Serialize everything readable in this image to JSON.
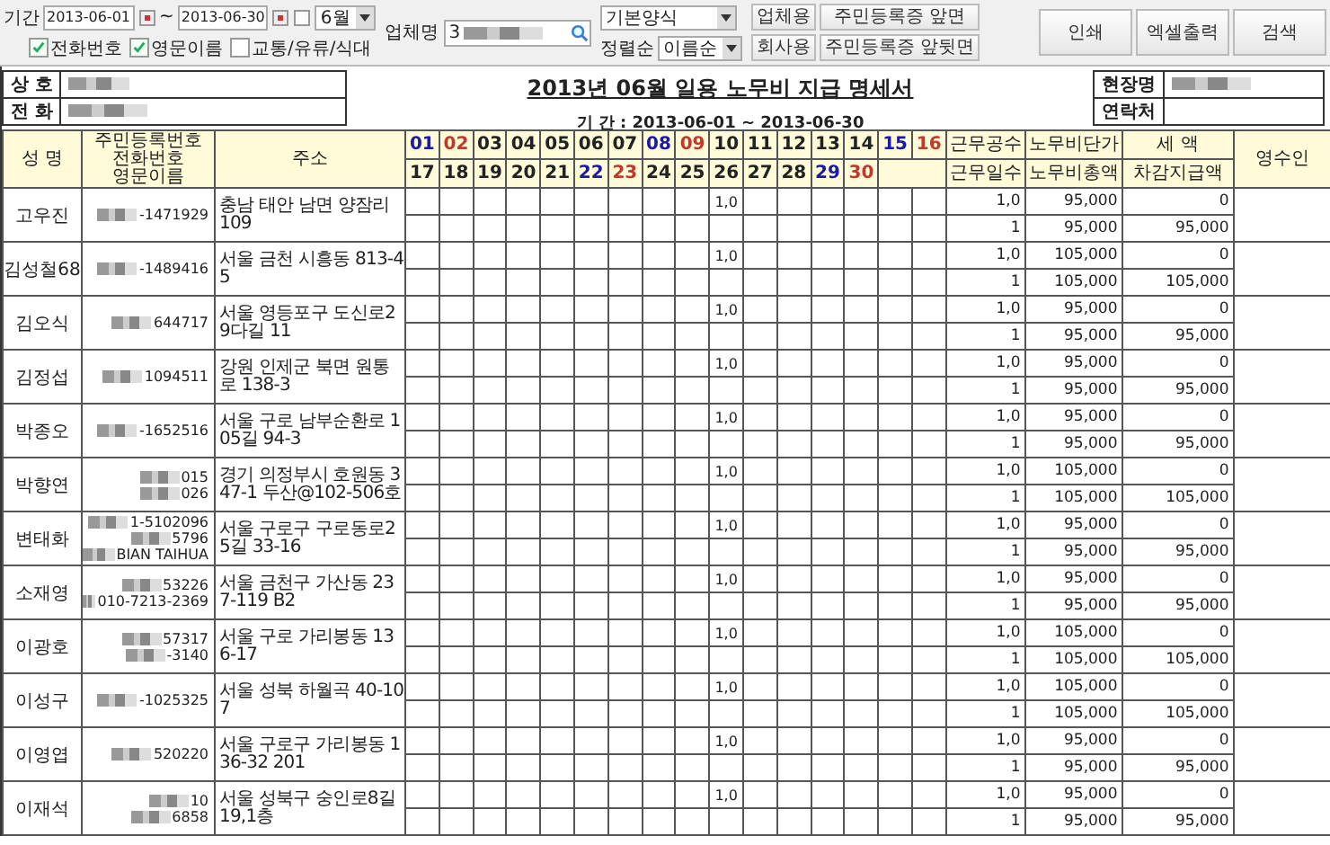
{
  "toolbar": {
    "period_label": "기간",
    "start_date": "2013-06-01",
    "separator": "~",
    "end_date": "2013-06-30",
    "month_select": "6월",
    "checkboxes": [
      {
        "label": "전화번호",
        "checked": true
      },
      {
        "label": "영문이름",
        "checked": true
      },
      {
        "label": "교통/유류/식대",
        "checked": false
      }
    ],
    "company_label": "업체명",
    "company_value": "3",
    "form_select": "기본양식",
    "sort_label": "정렬순",
    "sort_select": "이름순",
    "small_buttons": [
      "업체용",
      "주민등록증 앞면",
      "회사용",
      "주민등록증 앞뒷면"
    ],
    "big_buttons": [
      "인쇄",
      "엑셀출력",
      "검색"
    ]
  },
  "info": {
    "company_label": "상 호",
    "phone_label": "전 화",
    "title": "2013년 06월 일용 노무비 지급 명세서",
    "period": "기 간 : 2013-06-01 ~ 2013-06-30",
    "site_label": "현장명",
    "contact_label": "연락처"
  },
  "table": {
    "col_name": "성 명",
    "col_id": [
      "주민등록번호",
      "전화번호",
      "영문이름"
    ],
    "col_address": "주소",
    "days_top": [
      {
        "label": "01",
        "color": "#1a1aa6"
      },
      {
        "label": "02",
        "color": "#c0392b"
      },
      {
        "label": "03",
        "color": "#222222"
      },
      {
        "label": "04",
        "color": "#222222"
      },
      {
        "label": "05",
        "color": "#222222"
      },
      {
        "label": "06",
        "color": "#222222"
      },
      {
        "label": "07",
        "color": "#222222"
      },
      {
        "label": "08",
        "color": "#1a1aa6"
      },
      {
        "label": "09",
        "color": "#c0392b"
      },
      {
        "label": "10",
        "color": "#222222"
      },
      {
        "label": "11",
        "color": "#222222"
      },
      {
        "label": "12",
        "color": "#222222"
      },
      {
        "label": "13",
        "color": "#222222"
      },
      {
        "label": "14",
        "color": "#222222"
      },
      {
        "label": "15",
        "color": "#1a1aa6"
      },
      {
        "label": "16",
        "color": "#c0392b"
      }
    ],
    "days_bottom": [
      {
        "label": "17",
        "color": "#222222"
      },
      {
        "label": "18",
        "color": "#222222"
      },
      {
        "label": "19",
        "color": "#222222"
      },
      {
        "label": "20",
        "color": "#222222"
      },
      {
        "label": "21",
        "color": "#222222"
      },
      {
        "label": "22",
        "color": "#1a1aa6"
      },
      {
        "label": "23",
        "color": "#c0392b"
      },
      {
        "label": "24",
        "color": "#222222"
      },
      {
        "label": "25",
        "color": "#222222"
      },
      {
        "label": "26",
        "color": "#222222"
      },
      {
        "label": "27",
        "color": "#222222"
      },
      {
        "label": "28",
        "color": "#222222"
      },
      {
        "label": "29",
        "color": "#1a1aa6"
      },
      {
        "label": "30",
        "color": "#c0392b"
      }
    ],
    "col_work_units": "근무공수",
    "col_unit_price": "노무비단가",
    "col_tax": "세 액",
    "col_receipt": "영수인",
    "col_work_days": "근무일수",
    "col_total": "노무비총액",
    "col_net": "차감지급액",
    "rows": [
      {
        "name": "고우진",
        "id_lines": [
          "-1471929"
        ],
        "address": "충남 태안 남면 양잠리 109",
        "days_worked": [
          false,
          false,
          false,
          false,
          false,
          false,
          false,
          false,
          false,
          true,
          false,
          false,
          false,
          false,
          false,
          false
        ],
        "day_value": "1,0",
        "work_units": "1,0",
        "unit_price": "95,000",
        "tax": "0",
        "work_days": "1",
        "total": "95,000",
        "net": "95,000"
      },
      {
        "name": "김성철68",
        "id_lines": [
          "-1489416"
        ],
        "address": "서울 금천 시흥동 813-45",
        "days_worked": [
          false,
          false,
          false,
          false,
          false,
          false,
          false,
          false,
          false,
          true,
          false,
          false,
          false,
          false,
          false,
          false
        ],
        "day_value": "1,0",
        "work_units": "1,0",
        "unit_price": "105,000",
        "tax": "0",
        "work_days": "1",
        "total": "105,000",
        "net": "105,000"
      },
      {
        "name": "김오식",
        "id_lines": [
          "644717"
        ],
        "address": "서울 영등포구 도신로29다길 11",
        "days_worked": [
          false,
          false,
          false,
          false,
          false,
          false,
          false,
          false,
          false,
          true,
          false,
          false,
          false,
          false,
          false,
          false
        ],
        "day_value": "1,0",
        "work_units": "1,0",
        "unit_price": "95,000",
        "tax": "0",
        "work_days": "1",
        "total": "95,000",
        "net": "95,000"
      },
      {
        "name": "김정섭",
        "id_lines": [
          "1094511"
        ],
        "address": "강원 인제군 북면 원통로 138-3",
        "days_worked": [
          false,
          false,
          false,
          false,
          false,
          false,
          false,
          false,
          false,
          true,
          false,
          false,
          false,
          false,
          false,
          false
        ],
        "day_value": "1,0",
        "work_units": "1,0",
        "unit_price": "95,000",
        "tax": "0",
        "work_days": "1",
        "total": "95,000",
        "net": "95,000"
      },
      {
        "name": "박종오",
        "id_lines": [
          "-1652516"
        ],
        "address": "서울 구로 남부순환로 105길 94-3",
        "days_worked": [
          false,
          false,
          false,
          false,
          false,
          false,
          false,
          false,
          false,
          true,
          false,
          false,
          false,
          false,
          false,
          false
        ],
        "day_value": "1,0",
        "work_units": "1,0",
        "unit_price": "95,000",
        "tax": "0",
        "work_days": "1",
        "total": "95,000",
        "net": "95,000"
      },
      {
        "name": "박향연",
        "id_lines": [
          "015",
          "026"
        ],
        "address": "경기 의정부시 호원동 347-1 두산@102-506호",
        "days_worked": [
          false,
          false,
          false,
          false,
          false,
          false,
          false,
          false,
          false,
          true,
          false,
          false,
          false,
          false,
          false,
          false
        ],
        "day_value": "1,0",
        "work_units": "1,0",
        "unit_price": "105,000",
        "tax": "0",
        "work_days": "1",
        "total": "105,000",
        "net": "105,000"
      },
      {
        "name": "변태화",
        "id_lines": [
          "1-5102096",
          "5796",
          "BIAN TAIHUA"
        ],
        "address": "서울 구로구 구로동로25길 33-16",
        "days_worked": [
          false,
          false,
          false,
          false,
          false,
          false,
          false,
          false,
          false,
          true,
          false,
          false,
          false,
          false,
          false,
          false
        ],
        "day_value": "1,0",
        "work_units": "1,0",
        "unit_price": "95,000",
        "tax": "0",
        "work_days": "1",
        "total": "95,000",
        "net": "95,000"
      },
      {
        "name": "소재영",
        "id_lines": [
          "53226",
          "010-7213-2369"
        ],
        "address": "서울 금천구 가산동 237-119 B2",
        "days_worked": [
          false,
          false,
          false,
          false,
          false,
          false,
          false,
          false,
          false,
          true,
          false,
          false,
          false,
          false,
          false,
          false
        ],
        "day_value": "1,0",
        "work_units": "1,0",
        "unit_price": "95,000",
        "tax": "0",
        "work_days": "1",
        "total": "95,000",
        "net": "95,000"
      },
      {
        "name": "이광호",
        "id_lines": [
          "57317",
          "-3140"
        ],
        "address": "서울 구로 가리봉동 136-17",
        "days_worked": [
          false,
          false,
          false,
          false,
          false,
          false,
          false,
          false,
          false,
          true,
          false,
          false,
          false,
          false,
          false,
          false
        ],
        "day_value": "1,0",
        "work_units": "1,0",
        "unit_price": "105,000",
        "tax": "0",
        "work_days": "1",
        "total": "105,000",
        "net": "105,000"
      },
      {
        "name": "이성구",
        "id_lines": [
          "-1025325"
        ],
        "address": "서울 성북 하월곡 40-107",
        "days_worked": [
          false,
          false,
          false,
          false,
          false,
          false,
          false,
          false,
          false,
          true,
          false,
          false,
          false,
          false,
          false,
          false
        ],
        "day_value": "1,0",
        "work_units": "1,0",
        "unit_price": "105,000",
        "tax": "0",
        "work_days": "1",
        "total": "105,000",
        "net": "105,000"
      },
      {
        "name": "이영엽",
        "id_lines": [
          "520220"
        ],
        "address": "서울 구로구 가리봉동 136-32 201",
        "days_worked": [
          false,
          false,
          false,
          false,
          false,
          false,
          false,
          false,
          false,
          true,
          false,
          false,
          false,
          false,
          false,
          false
        ],
        "day_value": "1,0",
        "work_units": "1,0",
        "unit_price": "95,000",
        "tax": "0",
        "work_days": "1",
        "total": "95,000",
        "net": "95,000"
      },
      {
        "name": "이재석",
        "id_lines": [
          "10",
          "6858"
        ],
        "address": "서울 성북구 숭인로8길 19,1층",
        "days_worked": [
          false,
          false,
          false,
          false,
          false,
          false,
          false,
          false,
          false,
          true,
          false,
          false,
          false,
          false,
          false,
          false
        ],
        "day_value": "1,0",
        "work_units": "1,0",
        "unit_price": "95,000",
        "tax": "0",
        "work_days": "1",
        "total": "95,000",
        "net": "95,000"
      }
    ]
  }
}
